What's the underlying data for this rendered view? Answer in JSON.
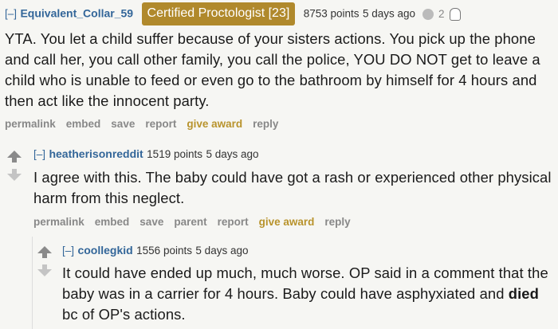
{
  "comment1": {
    "toggle": "[–]",
    "author": "Equivalent_Collar_59",
    "flair": "Certified Proctologist [23]",
    "points": "8753 points",
    "age": "5 days ago",
    "award_count": "2",
    "body": "YTA. You let a child suffer because of your sisters actions. You pick up the phone and call her, you call other family, you call the police, YOU DO NOT get to leave a child who is unable to feed or even go to the bathroom by himself for 4 hours and then act like the innocent party.",
    "actions": [
      "permalink",
      "embed",
      "save",
      "report",
      "give award",
      "reply"
    ]
  },
  "comment2": {
    "toggle": "[–]",
    "author": "heatherisonreddit",
    "points": "1519 points",
    "age": "5 days ago",
    "body": "I agree with this. The baby could have got a rash or experienced other physical harm from this neglect.",
    "actions": [
      "permalink",
      "embed",
      "save",
      "parent",
      "report",
      "give award",
      "reply"
    ]
  },
  "comment3": {
    "toggle": "[–]",
    "author": "coollegkid",
    "points": "1556 points",
    "age": "5 days ago",
    "body_before": "It could have ended up much, much worse. OP said in a comment that the baby was in a carrier for 4 hours. Baby could have asphyxiated and ",
    "body_bold": "died",
    "body_after": " bc of OP's actions."
  }
}
